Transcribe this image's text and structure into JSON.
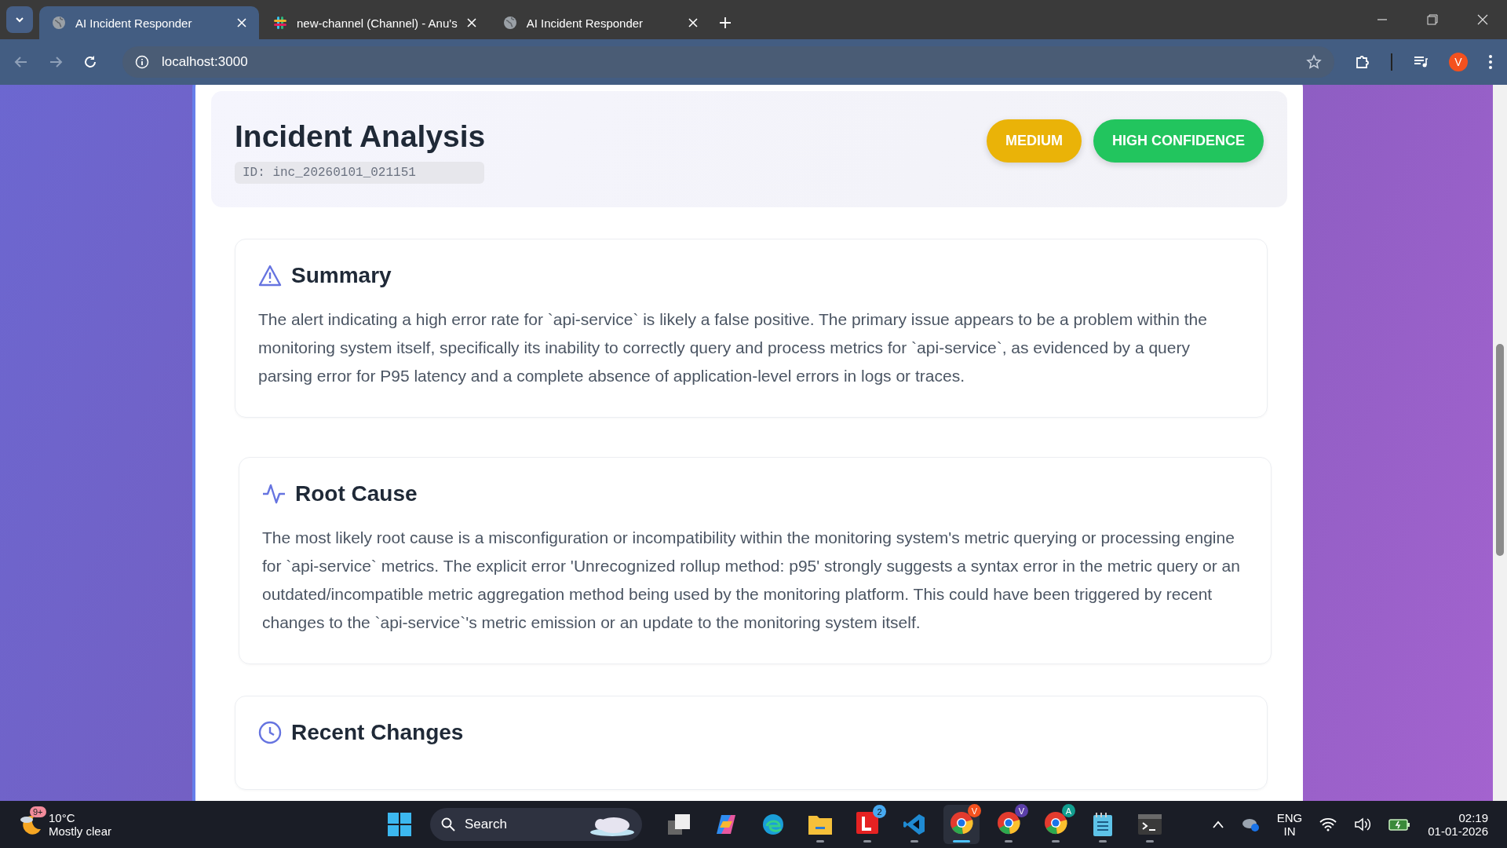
{
  "browser": {
    "tabs": [
      {
        "title": "AI Incident Responder",
        "kind": "web",
        "selected": true
      },
      {
        "title": "new-channel (Channel) - Anu's",
        "kind": "chat",
        "selected": false
      },
      {
        "title": "AI Incident Responder",
        "kind": "web",
        "selected": false
      }
    ],
    "address": "localhost:3000",
    "profile_initial": "V"
  },
  "page": {
    "title": "Incident Analysis",
    "id_label": "ID: inc_20260101_021151",
    "badges": [
      {
        "label": "MEDIUM",
        "color": "#eab308"
      },
      {
        "label": "HIGH CONFIDENCE",
        "color": "#22c55e"
      }
    ],
    "sections": [
      {
        "kind": "alert",
        "title": "Summary",
        "text": "The alert indicating a high error rate for `api-service` is likely a false positive. The primary issue appears to be a problem within the monitoring system itself, specifically its inability to correctly query and process metrics for `api-service`, as evidenced by a query parsing error for P95 latency and a complete absence of application-level errors in logs or traces."
      },
      {
        "kind": "activity",
        "title": "Root Cause",
        "text": "The most likely root cause is a misconfiguration or incompatibility within the monitoring system's metric querying or processing engine for `api-service` metrics. The explicit error 'Unrecognized rollup method: p95' strongly suggests a syntax error in the metric query or an outdated/incompatible metric aggregation method being used by the monitoring platform. This could have been triggered by recent changes to the `api-service`'s metric emission or an update to the monitoring system itself."
      },
      {
        "kind": "clock",
        "title": "Recent Changes"
      }
    ]
  },
  "taskbar": {
    "weather": {
      "temperature": "10°C",
      "condition": "Mostly clear",
      "badge": "9+"
    },
    "search_placeholder": "Search",
    "apps": [
      {
        "kind": "taskview",
        "running": false,
        "selected": false
      },
      {
        "kind": "copilot",
        "running": false,
        "selected": false
      },
      {
        "kind": "edge",
        "running": false,
        "selected": false
      },
      {
        "kind": "files",
        "running": true,
        "selected": false
      },
      {
        "kind": "letter",
        "badge": "2",
        "running": true,
        "selected": false
      },
      {
        "kind": "code",
        "running": true,
        "selected": false
      },
      {
        "kind": "chrome",
        "badge": "V",
        "color": "#f4511e",
        "running": true,
        "selected": true
      },
      {
        "kind": "chrome",
        "badge": "V",
        "color": "#5b3fa8",
        "running": true,
        "selected": false
      },
      {
        "kind": "chrome",
        "badge": "A",
        "color": "#129e8f",
        "running": true,
        "selected": false
      },
      {
        "kind": "notepad",
        "running": true,
        "selected": false
      },
      {
        "kind": "terminal",
        "running": true,
        "selected": false
      }
    ],
    "language": "ENG",
    "region": "IN",
    "time": "02:19",
    "date": "01-01-2026"
  }
}
